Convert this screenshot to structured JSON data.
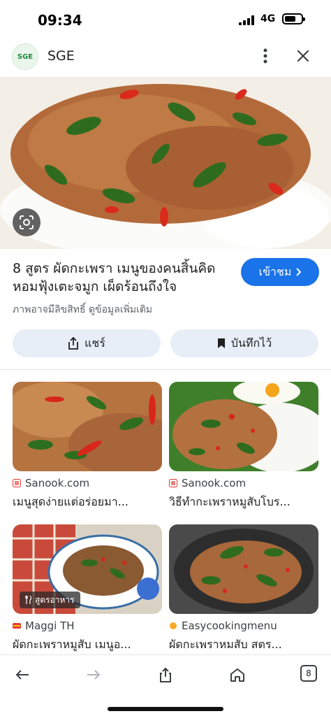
{
  "status": {
    "time": "09:34",
    "network": "4G"
  },
  "header": {
    "logo_text": "SGE",
    "site_name": "SGE"
  },
  "result": {
    "title": "8 สูตร ผัดกะเพรา เมนูของคนสิ้นคิด หอมฟุ้งเตะจมูก เผ็ดร้อนถึงใจ",
    "visit_label": "เข้าชม",
    "rights_note": "ภาพอาจมีลิขสิทธิ์ ดูข้อมูลเพิ่มเติม",
    "share_label": "แชร์",
    "save_label": "บันทึกไว้"
  },
  "cards": [
    {
      "source": "Sanook.com",
      "caption": "เมนูสุดง่ายแต่อร่อยมา...",
      "tag": ""
    },
    {
      "source": "Sanook.com",
      "caption": "วิธีทำกะเพราหมูสับโบร...",
      "tag": ""
    },
    {
      "source": "Maggi TH",
      "caption": "ผัดกะเพราหมูสับ เมนูอ...",
      "tag": "สูตรอาหาร"
    },
    {
      "source": "Easycookingmenu",
      "caption": "ผัดกะเพราหมสับ สตร...",
      "tag": ""
    }
  ],
  "bottom": {
    "tab_count": "8"
  },
  "colors": {
    "accent": "#1a73e8",
    "pill": "#e8eef8",
    "sanook": "#e53935",
    "maggi": "#e53935",
    "easycooking": "#f9a825"
  }
}
